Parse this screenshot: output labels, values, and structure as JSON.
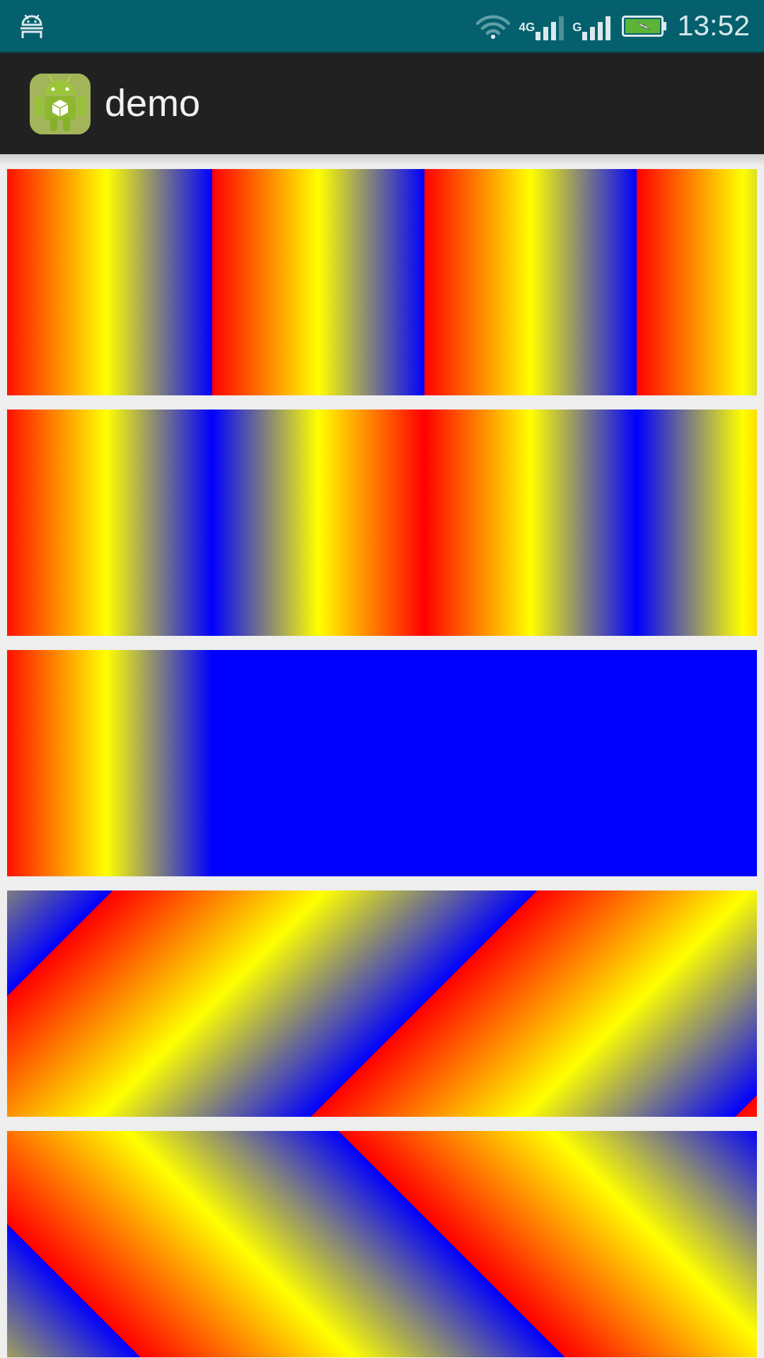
{
  "status_bar": {
    "signals": [
      {
        "label": "4G"
      },
      {
        "label": "G"
      }
    ],
    "time": "13:52"
  },
  "app_bar": {
    "title": "demo"
  },
  "gradient_panels": [
    {
      "kind": "repeat"
    },
    {
      "kind": "mirror"
    },
    {
      "kind": "clamp"
    },
    {
      "kind": "rising"
    },
    {
      "kind": "falling"
    }
  ]
}
